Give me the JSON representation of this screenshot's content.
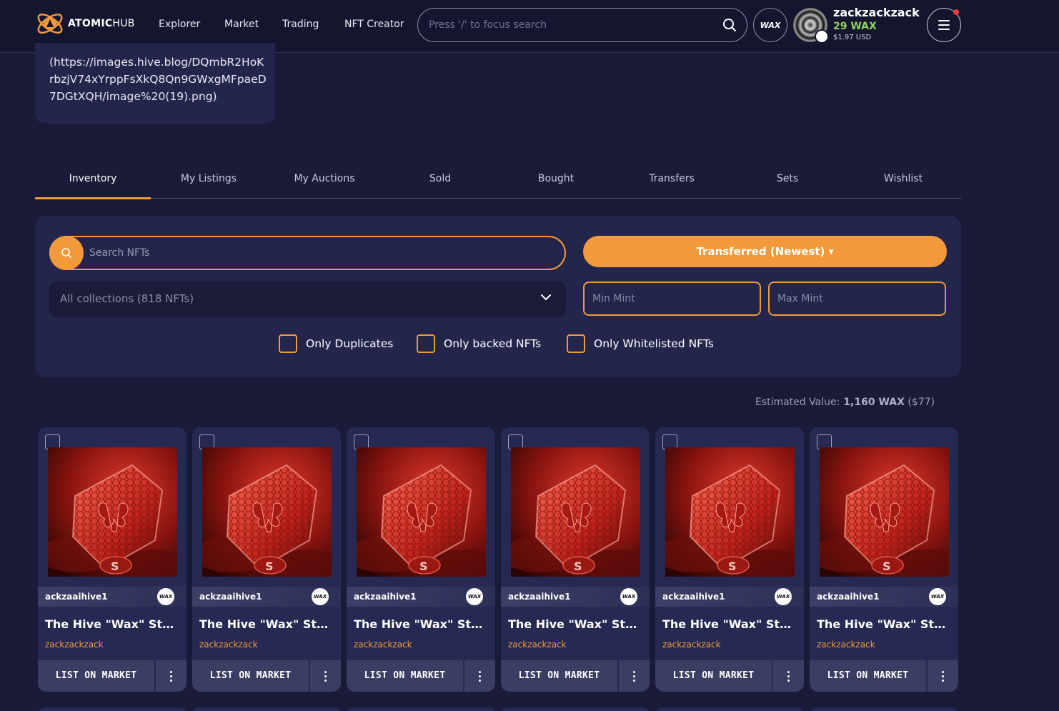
{
  "header": {
    "logo_bold": "ATOMIC",
    "logo_light": "HUB",
    "nav": [
      "Explorer",
      "Market",
      "Trading",
      "NFT Creator"
    ],
    "search_placeholder": "Press '/' to focus search",
    "wax_label": "WAX",
    "user": {
      "name": "zackzackzack",
      "balance": "29 WAX",
      "usd": "$1.97 USD"
    }
  },
  "description": {
    "text": "(https://images.hive.blog/DQmbR2HoKrbzjV74xYrppFsXkQ8Qn9GWxgMFpaeD7DGtXQH/image%20(19).png)"
  },
  "tabs": [
    "Inventory",
    "My Listings",
    "My Auctions",
    "Sold",
    "Bought",
    "Transfers",
    "Sets",
    "Wishlist"
  ],
  "active_tab": "Inventory",
  "filters": {
    "search_placeholder": "Search NFTs",
    "sort_label": "Transferred (Newest)",
    "collection_value": "All collections (818 NFTs)",
    "min_mint_placeholder": "Min Mint",
    "max_mint_placeholder": "Max Mint",
    "checkboxes": [
      "Only Duplicates",
      "Only backed NFTs",
      "Only Whitelisted NFTs"
    ]
  },
  "estimated": {
    "label": "Estimated Value:",
    "value": "1,160 WAX",
    "usd": "($77)"
  },
  "cards": [
    {
      "collection": "ackzaaihive1",
      "title": "The Hive \"Wax\" Stamp",
      "owner": "zackzackzack",
      "list_label": "LIST ON MARKET"
    },
    {
      "collection": "ackzaaihive1",
      "title": "The Hive \"Wax\" Stamp",
      "owner": "zackzackzack",
      "list_label": "LIST ON MARKET"
    },
    {
      "collection": "ackzaaihive1",
      "title": "The Hive \"Wax\" Stamp",
      "owner": "zackzackzack",
      "list_label": "LIST ON MARKET"
    },
    {
      "collection": "ackzaaihive1",
      "title": "The Hive \"Wax\" Stamp",
      "owner": "zackzackzack",
      "list_label": "LIST ON MARKET"
    },
    {
      "collection": "ackzaaihive1",
      "title": "The Hive \"Wax\" Stamp",
      "owner": "zackzackzack",
      "list_label": "LIST ON MARKET"
    },
    {
      "collection": "ackzaaihive1",
      "title": "The Hive \"Wax\" Stamp",
      "owner": "zackzackzack",
      "list_label": "LIST ON MARKET"
    }
  ],
  "colors": {
    "accent": "#f29a3b",
    "background": "#191b38",
    "panel": "#23264a",
    "wax_green": "#8fd45f"
  },
  "icons": [
    "atomic-logo-icon",
    "search-icon",
    "wax-icon",
    "menu-icon",
    "chevron-down-icon",
    "more-vertical-icon",
    "checkbox-icon"
  ]
}
